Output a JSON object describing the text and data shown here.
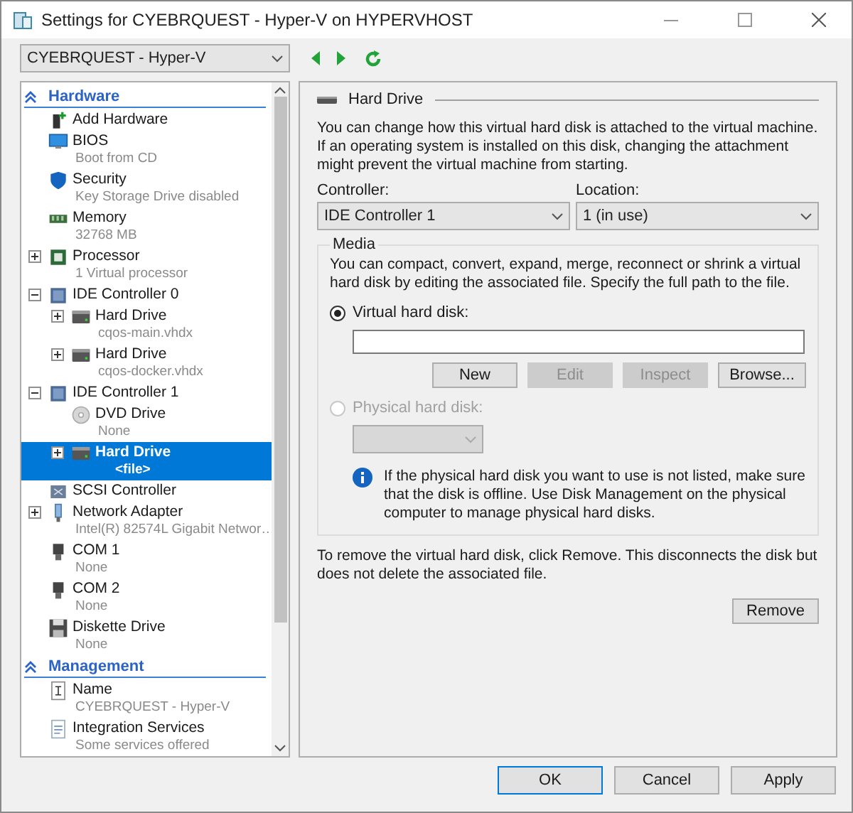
{
  "window": {
    "title": "Settings for CYEBRQUEST - Hyper-V on HYPERVHOST"
  },
  "vm_selector": {
    "value": "CYEBRQUEST - Hyper-V"
  },
  "tree": {
    "sections": [
      {
        "title": "Hardware",
        "expanded": true,
        "items": [
          {
            "kind": "add-hardware",
            "label": "Add Hardware",
            "selected": false
          },
          {
            "kind": "bios",
            "label": "BIOS",
            "detail": "Boot from CD",
            "selected": false
          },
          {
            "kind": "security",
            "label": "Security",
            "detail": "Key Storage Drive disabled",
            "selected": false
          },
          {
            "kind": "memory",
            "label": "Memory",
            "detail": "32768 MB",
            "selected": false
          },
          {
            "kind": "processor",
            "label": "Processor",
            "detail": "1 Virtual processor",
            "expanded": false,
            "selected": false
          },
          {
            "kind": "controller",
            "label": "IDE Controller 0",
            "expanded": true,
            "selected": false,
            "children": [
              {
                "kind": "hard-drive",
                "label": "Hard Drive",
                "detail": "cqos-main.vhdx",
                "expanded": false,
                "selected": false
              },
              {
                "kind": "hard-drive",
                "label": "Hard Drive",
                "detail": "cqos-docker.vhdx",
                "expanded": false,
                "selected": false
              }
            ]
          },
          {
            "kind": "controller",
            "label": "IDE Controller 1",
            "expanded": true,
            "selected": false,
            "children": [
              {
                "kind": "dvd-drive",
                "label": "DVD Drive",
                "detail": "None",
                "selected": false
              },
              {
                "kind": "hard-drive",
                "label": "Hard Drive",
                "detail": "<file>",
                "expanded": false,
                "selected": true
              }
            ]
          },
          {
            "kind": "scsi",
            "label": "SCSI Controller",
            "selected": false
          },
          {
            "kind": "network",
            "label": "Network Adapter",
            "detail": "Intel(R) 82574L Gigabit Networ…",
            "expanded": false,
            "selected": false
          },
          {
            "kind": "com-port",
            "label": "COM 1",
            "detail": "None",
            "selected": false
          },
          {
            "kind": "com-port",
            "label": "COM 2",
            "detail": "None",
            "selected": false
          },
          {
            "kind": "diskette",
            "label": "Diskette Drive",
            "detail": "None",
            "selected": false
          }
        ]
      },
      {
        "title": "Management",
        "expanded": true,
        "items": [
          {
            "kind": "name",
            "label": "Name",
            "detail": "CYEBRQUEST - Hyper-V",
            "selected": false
          },
          {
            "kind": "integration",
            "label": "Integration Services",
            "detail": "Some services offered",
            "selected": false
          }
        ]
      }
    ]
  },
  "details": {
    "title": "Hard Drive",
    "intro": "You can change how this virtual hard disk is attached to the virtual machine. If an operating system is installed on this disk, changing the attachment might prevent the virtual machine from starting.",
    "controller": {
      "label": "Controller:",
      "value": "IDE Controller 1"
    },
    "location": {
      "label": "Location:",
      "value": "1 (in use)"
    },
    "media": {
      "title": "Media",
      "text": "You can compact, convert, expand, merge, reconnect or shrink a virtual hard disk by editing the associated file. Specify the full path to the file.",
      "options": [
        {
          "label": "Virtual hard disk:",
          "selected": true,
          "disabled": false
        },
        {
          "label": "Physical hard disk:",
          "selected": false,
          "disabled": true
        }
      ],
      "path_buttons": [
        {
          "label": "New",
          "disabled": false
        },
        {
          "label": "Edit",
          "disabled": true
        },
        {
          "label": "Inspect",
          "disabled": true
        },
        {
          "label": "Browse...",
          "disabled": false
        }
      ],
      "info": "If the physical hard disk you want to use is not listed, make sure that the disk is offline. Use Disk Management on the physical computer to manage physical hard disks."
    },
    "remove_text": "To remove the virtual hard disk, click Remove. This disconnects the disk but does not delete the associated file.",
    "remove_button": "Remove"
  },
  "buttons": [
    {
      "label": "OK",
      "default": true
    },
    {
      "label": "Cancel",
      "default": false
    },
    {
      "label": "Apply",
      "default": false
    }
  ]
}
